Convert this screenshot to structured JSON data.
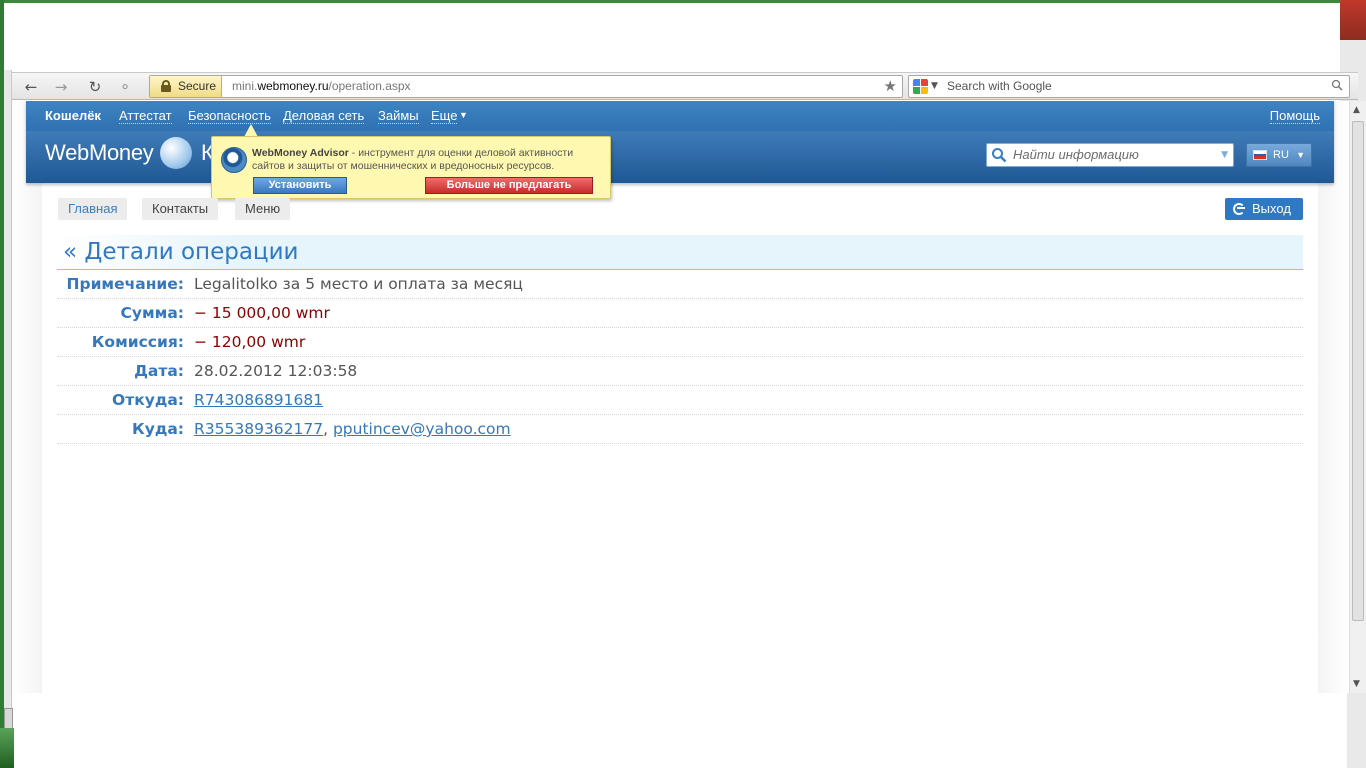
{
  "browser": {
    "secure_label": "Secure",
    "url_prefix": "mini.",
    "url_domain": "webmoney.ru",
    "url_path": "/operation.aspx",
    "search_placeholder": "Search with Google"
  },
  "header": {
    "nav": [
      "Кошелёк",
      "Аттестат",
      "Безопасность",
      "Деловая сеть",
      "Займы",
      "Еще"
    ],
    "help": "Помощь",
    "logo_text": "WebMoney",
    "logo_suffix": "К",
    "search_placeholder": "Найти информацию",
    "language": "RU"
  },
  "advisor": {
    "title": "WebMoney Advisor",
    "text": " - инструмент для оценки деловой активности сайтов и защиты от мошеннических и вредоносных ресурсов.",
    "install_label": "Установить",
    "dismiss_label": "Больше не предлагать"
  },
  "subnav": {
    "tabs": [
      "Главная",
      "Контакты",
      "Меню"
    ],
    "logout_label": "Выход"
  },
  "operation": {
    "heading": "« Детали операции",
    "fields": [
      {
        "label": "Примечание:",
        "value": "Legalitolko за 5 место и оплата за месяц"
      },
      {
        "label": "Сумма:",
        "value": "− 15 000,00 wmr"
      },
      {
        "label": "Комиссия:",
        "value": "− 120,00 wmr"
      },
      {
        "label": "Дата:",
        "value": "28.02.2012 12:03:58"
      },
      {
        "label": "Откуда:",
        "value": "R743086891681"
      },
      {
        "label": "Куда:",
        "value": "R355389362177",
        "value2": "pputincev@yahoo.com",
        "separator": ", "
      }
    ]
  },
  "colors": {
    "accent": "#2f79c3",
    "header_blue": "#2e6fb0",
    "negative": "#8b0000",
    "advisor_bg": "#fff8b0"
  }
}
